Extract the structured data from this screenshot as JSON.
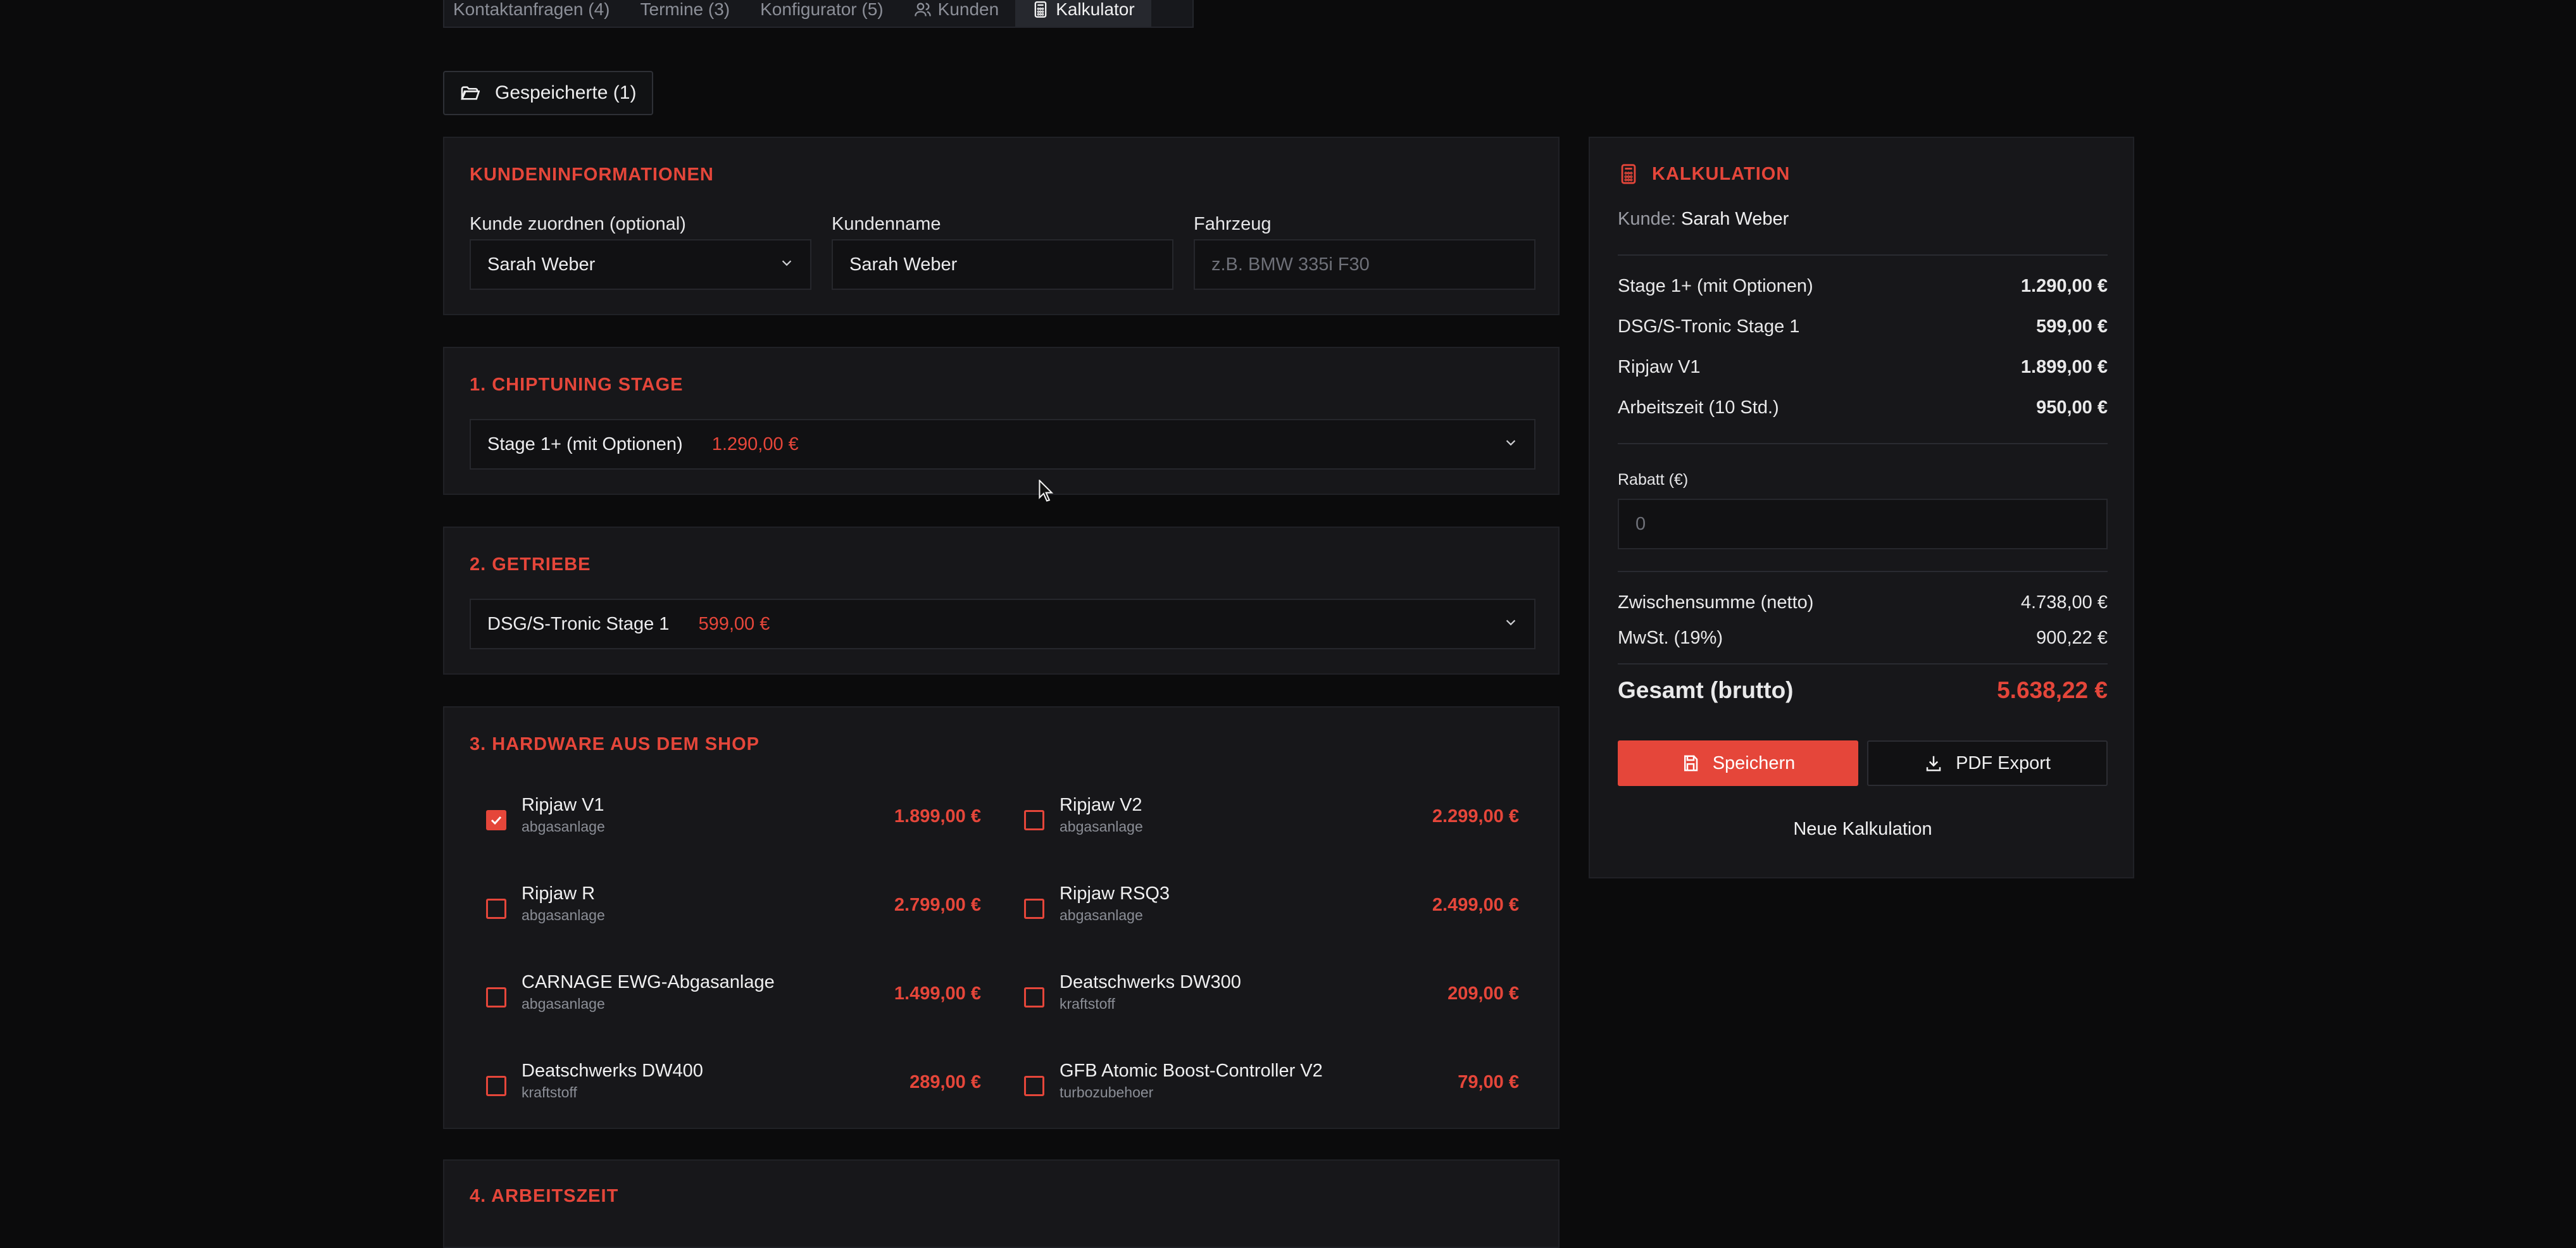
{
  "tabs": [
    {
      "label": "Kontaktanfragen (4)"
    },
    {
      "label": "Termine (3)"
    },
    {
      "label": "Konfigurator (5)"
    },
    {
      "label": "Kunden",
      "icon": "users-icon"
    },
    {
      "label": "Kalkulator",
      "icon": "calculator-icon",
      "active": true
    }
  ],
  "saved_button": {
    "label": "Gespeicherte (1)",
    "icon": "folder-open-icon"
  },
  "customer_section": {
    "title": "KUNDENINFORMATIONEN",
    "assign_label": "Kunde zuordnen (optional)",
    "assign_value": "Sarah Weber",
    "name_label": "Kundenname",
    "name_value": "Sarah Weber",
    "vehicle_label": "Fahrzeug",
    "vehicle_placeholder": "z.B. BMW 335i F30"
  },
  "stage_section": {
    "title": "1. CHIPTUNING STAGE",
    "selected_label": "Stage 1+ (mit Optionen)",
    "selected_price": "1.290,00 €"
  },
  "gearbox_section": {
    "title": "2. GETRIEBE",
    "selected_label": "DSG/S-Tronic Stage 1",
    "selected_price": "599,00 €"
  },
  "hardware_section": {
    "title": "3. HARDWARE AUS DEM SHOP",
    "items": [
      {
        "name": "Ripjaw V1",
        "category": "abgasanlage",
        "price": "1.899,00 €",
        "checked": true
      },
      {
        "name": "Ripjaw V2",
        "category": "abgasanlage",
        "price": "2.299,00 €",
        "checked": false
      },
      {
        "name": "Ripjaw R",
        "category": "abgasanlage",
        "price": "2.799,00 €",
        "checked": false
      },
      {
        "name": "Ripjaw RSQ3",
        "category": "abgasanlage",
        "price": "2.499,00 €",
        "checked": false
      },
      {
        "name": "CARNAGE EWG-Abgasanlage",
        "category": "abgasanlage",
        "price": "1.499,00 €",
        "checked": false
      },
      {
        "name": "Deatschwerks DW300",
        "category": "kraftstoff",
        "price": "209,00 €",
        "checked": false
      },
      {
        "name": "Deatschwerks DW400",
        "category": "kraftstoff",
        "price": "289,00 €",
        "checked": false
      },
      {
        "name": "GFB Atomic Boost-Controller V2",
        "category": "turbozubehoer",
        "price": "79,00 €",
        "checked": false
      }
    ]
  },
  "labor_section": {
    "title": "4. ARBEITSZEIT"
  },
  "summary": {
    "title": "KALKULATION",
    "customer_prefix": "Kunde:",
    "customer_name": "Sarah Weber",
    "lines": [
      {
        "label": "Stage 1+ (mit Optionen)",
        "value": "1.290,00 €"
      },
      {
        "label": "DSG/S-Tronic Stage 1",
        "value": "599,00 €"
      },
      {
        "label": "Ripjaw V1",
        "value": "1.899,00 €"
      },
      {
        "label": "Arbeitszeit (10 Std.)",
        "value": "950,00 €"
      }
    ],
    "discount_label": "Rabatt (€)",
    "discount_placeholder": "0",
    "subtotal_label": "Zwischensumme (netto)",
    "subtotal_value": "4.738,00 €",
    "vat_label": "MwSt. (19%)",
    "vat_value": "900,22 €",
    "total_label": "Gesamt (brutto)",
    "total_value": "5.638,22 €",
    "save_label": "Speichern",
    "pdf_label": "PDF Export",
    "new_label": "Neue Kalkulation"
  },
  "colors": {
    "accent": "#e5463a",
    "background": "#0b0b0c",
    "panel": "#17171a"
  }
}
